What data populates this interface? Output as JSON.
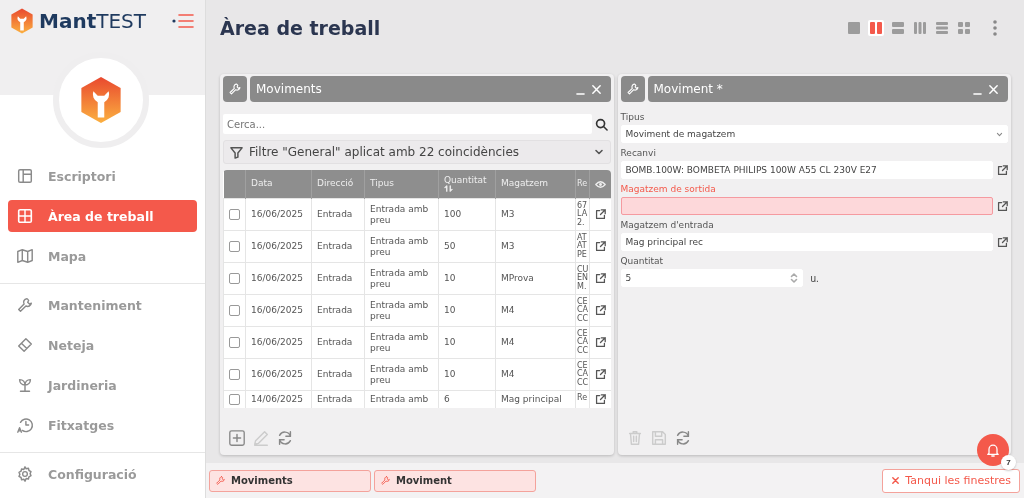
{
  "app": {
    "logo_bold": "Mant",
    "logo_light": "TEST"
  },
  "sidebar": {
    "items": [
      {
        "label": "Escriptori",
        "kind": "desktop",
        "selected": false,
        "divider": false
      },
      {
        "label": "Àrea de treball",
        "kind": "grid",
        "selected": true,
        "divider": false
      },
      {
        "label": "Mapa",
        "kind": "map",
        "selected": false,
        "divider": false
      },
      {
        "label": "Manteniment",
        "kind": "wrench",
        "selected": false,
        "divider": true
      },
      {
        "label": "Neteja",
        "kind": "brush",
        "selected": false,
        "divider": false
      },
      {
        "label": "Jardineria",
        "kind": "plant",
        "selected": false,
        "divider": false
      },
      {
        "label": "Fitxatges",
        "kind": "clock",
        "selected": false,
        "divider": false
      },
      {
        "label": "Configuració",
        "kind": "gear",
        "selected": false,
        "divider": true
      }
    ]
  },
  "header": {
    "title": "Àrea de treball",
    "layouts": [
      {
        "kind": "single",
        "selected": false
      },
      {
        "kind": "two-cols",
        "selected": true
      },
      {
        "kind": "two-rows",
        "selected": false
      },
      {
        "kind": "three-cols",
        "selected": false
      },
      {
        "kind": "three-rows",
        "selected": false
      },
      {
        "kind": "grid",
        "selected": false
      }
    ]
  },
  "list_window": {
    "title": "Moviments",
    "search": {
      "placeholder": "Cerca..."
    },
    "filter": "Filtre \"General\" aplicat amb 22 coincidències",
    "table": {
      "columns": [
        "Data",
        "Direcció",
        "Tipus",
        "Quantitat",
        "Magatzem",
        "Re"
      ],
      "rows": [
        {
          "checked": false,
          "cells": [
            "16/06/2025",
            "Entrada",
            "Entrada amb preu",
            "100",
            "M3",
            "67 LA 2."
          ]
        },
        {
          "checked": false,
          "cells": [
            "16/06/2025",
            "Entrada",
            "Entrada amb preu",
            "50",
            "M3",
            "AT AT PE"
          ]
        },
        {
          "checked": false,
          "cells": [
            "16/06/2025",
            "Entrada",
            "Entrada amb preu",
            "10",
            "MProva",
            "CU EN M."
          ]
        },
        {
          "checked": false,
          "cells": [
            "16/06/2025",
            "Entrada",
            "Entrada amb preu",
            "10",
            "M4",
            "CE CA CC"
          ]
        },
        {
          "checked": false,
          "cells": [
            "16/06/2025",
            "Entrada",
            "Entrada amb preu",
            "10",
            "M4",
            "CE CA CC"
          ]
        },
        {
          "checked": false,
          "cells": [
            "16/06/2025",
            "Entrada",
            "Entrada amb preu",
            "10",
            "M4",
            "CE CA CC"
          ]
        },
        {
          "checked": false,
          "cells": [
            "14/06/2025",
            "Entrada",
            "Entrada amb",
            "6",
            "Mag principal",
            "Re"
          ]
        }
      ]
    },
    "toolbar": [
      {
        "kind": "add",
        "disabled": false
      },
      {
        "kind": "edit",
        "disabled": true
      },
      {
        "kind": "refresh",
        "disabled": false
      }
    ]
  },
  "form_window": {
    "title": "Moviment *",
    "fields": [
      {
        "label": "Tipus",
        "kind": "select",
        "value": "Moviment de magatzem",
        "error": false
      },
      {
        "label": "Recanvi",
        "kind": "lookup",
        "value": "BOMB.100W: BOMBETA PHILIPS 100W A55 CL 230V E27",
        "error": false
      },
      {
        "label": "Magatzem de sortida",
        "kind": "lookup",
        "error": true
      },
      {
        "label": "Magatzem d'entrada",
        "kind": "lookup",
        "value": "Mag principal rec",
        "error": false
      },
      {
        "label": "Quantitat",
        "kind": "number",
        "value": "5",
        "unit": "u.",
        "error": false
      }
    ],
    "toolbar": [
      {
        "kind": "delete",
        "disabled": true
      },
      {
        "kind": "save",
        "disabled": true
      },
      {
        "kind": "refresh",
        "disabled": false
      }
    ]
  },
  "notifications": {
    "count": "7"
  },
  "taskbar": {
    "tabs": [
      "Moviments",
      "Moviment"
    ],
    "close_all": "Tanqui les finestres"
  }
}
